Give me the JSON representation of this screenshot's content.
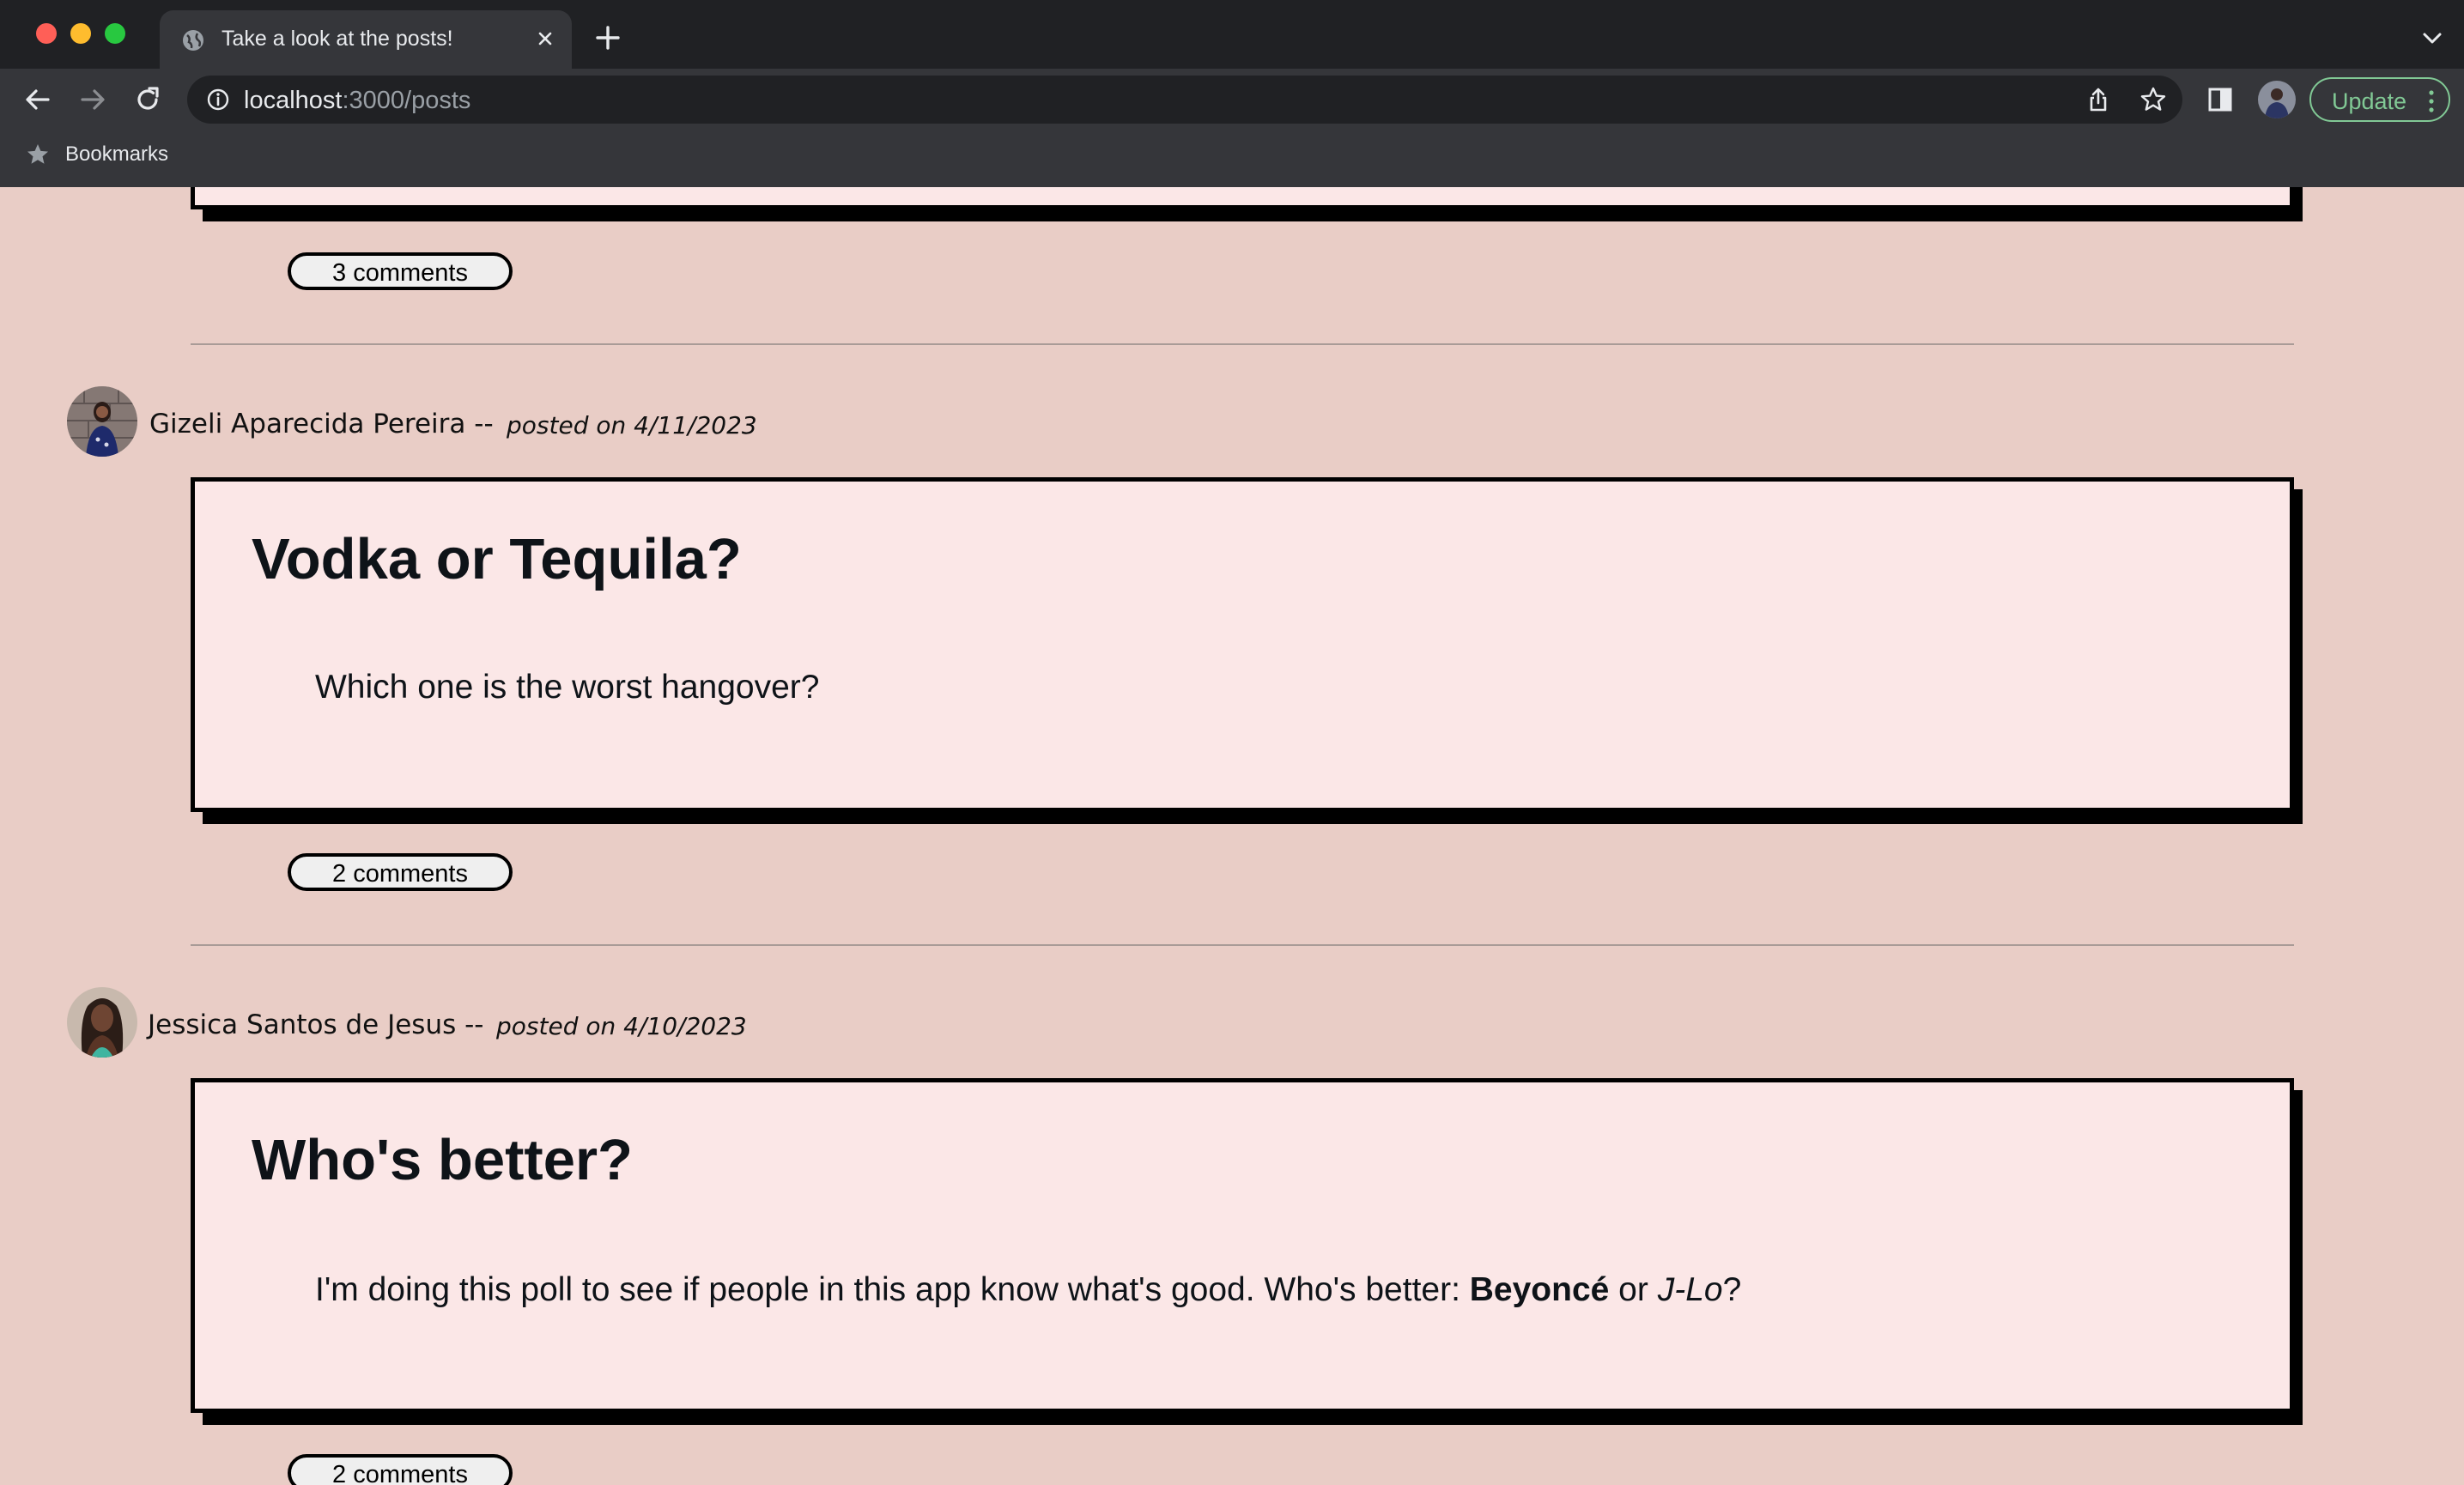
{
  "browser": {
    "tab_title": "Take a look at the posts!",
    "url_host": "localhost",
    "url_path": ":3000/posts",
    "update_label": "Update",
    "bookmarks_label": "Bookmarks"
  },
  "posts": {
    "previous": {
      "comments_label": "3 comments"
    },
    "post_1": {
      "author": "Gizeli Aparecida Pereira",
      "separator": "--",
      "posted_on": "posted on 4/11/2023",
      "title": "Vodka or Tequila?",
      "body": "Which one is the worst hangover?",
      "comments_label": "2 comments"
    },
    "post_2": {
      "author": "Jessica Santos de Jesus",
      "separator": "--",
      "posted_on": "posted on 4/10/2023",
      "title": "Who's better?",
      "body_prefix": "I'm doing this poll to see if people in this app know what's good. Who's better: ",
      "body_bold": "Beyoncé",
      "body_mid": " or ",
      "body_italic": "J-Lo",
      "body_suffix": "?",
      "comments_label": "2 comments"
    }
  },
  "colors": {
    "page_bg": "#e9cdc6",
    "card_bg": "#fbe7e7",
    "update_accent": "#81c995"
  }
}
